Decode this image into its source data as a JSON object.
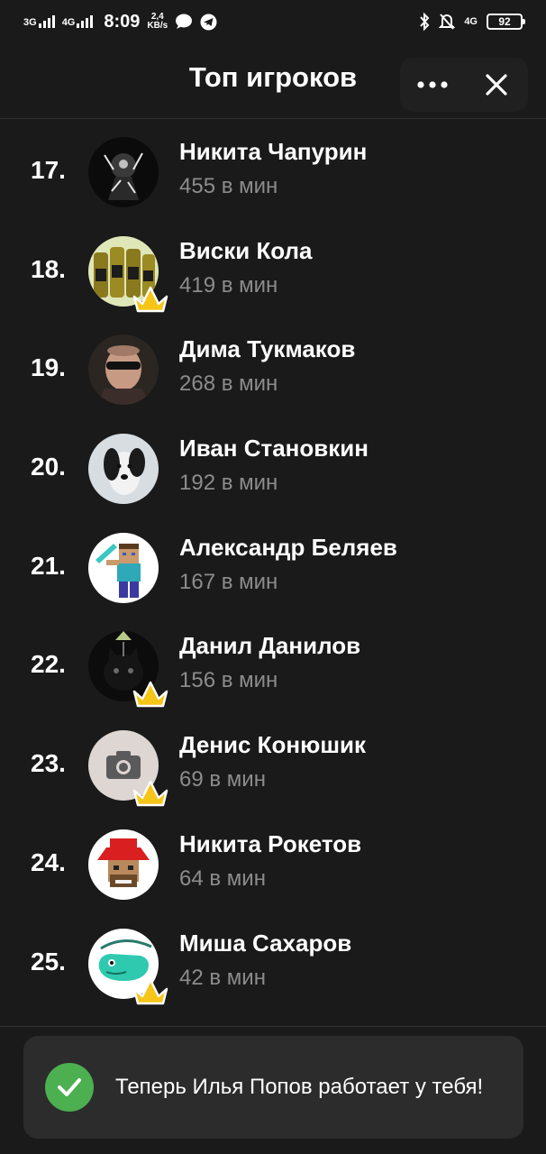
{
  "status_bar": {
    "network_1": "3G",
    "network_2": "4G",
    "time": "8:09",
    "speed_value": "2,4",
    "speed_unit": "KB/s",
    "network_right": "4G",
    "battery": "92"
  },
  "header": {
    "title": "Топ игроков"
  },
  "players": [
    {
      "rank": "17.",
      "name": "Никита Чапурин",
      "stat": "455 в мин",
      "crown": false
    },
    {
      "rank": "18.",
      "name": "Виски Кола",
      "stat": "419 в мин",
      "crown": true
    },
    {
      "rank": "19.",
      "name": "Дима Тукмаков",
      "stat": "268 в мин",
      "crown": false
    },
    {
      "rank": "20.",
      "name": "Иван Становкин",
      "stat": "192 в мин",
      "crown": false
    },
    {
      "rank": "21.",
      "name": "Александр Беляев",
      "stat": "167 в мин",
      "crown": false
    },
    {
      "rank": "22.",
      "name": "Данил Данилов",
      "stat": "156 в мин",
      "crown": true
    },
    {
      "rank": "23.",
      "name": "Денис Конюшик",
      "stat": "69 в мин",
      "crown": true
    },
    {
      "rank": "24.",
      "name": "Никита Рокетов",
      "stat": "64 в мин",
      "crown": false
    },
    {
      "rank": "25.",
      "name": "Миша Сахаров",
      "stat": "42 в мин",
      "crown": true
    }
  ],
  "toast": {
    "text": "Теперь Илья Попов работает у тебя!"
  },
  "colors": {
    "background": "#1a1a1a",
    "secondary_text": "#8c8c8c",
    "crown": "#f5c518",
    "success": "#4caf50"
  }
}
